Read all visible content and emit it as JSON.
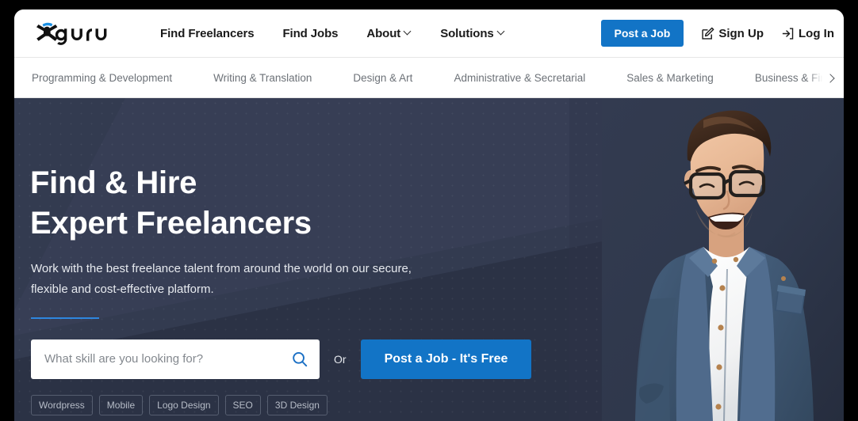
{
  "header": {
    "logo_text": "guru",
    "logo_icon": "guru-stickman-logo",
    "nav": [
      {
        "label": "Find Freelancers",
        "has_dropdown": false
      },
      {
        "label": "Find Jobs",
        "has_dropdown": false
      },
      {
        "label": "About",
        "has_dropdown": true
      },
      {
        "label": "Solutions",
        "has_dropdown": true
      }
    ],
    "post_job_label": "Post a Job",
    "sign_up_label": "Sign Up",
    "sign_up_icon": "pencil-edit-icon",
    "log_in_label": "Log In",
    "log_in_icon": "login-arrow-icon"
  },
  "categories": {
    "items": [
      "Programming & Development",
      "Writing & Translation",
      "Design & Art",
      "Administrative & Secretarial",
      "Sales & Marketing",
      "Business & Finance"
    ],
    "scroll_next_icon": "chevron-right-icon"
  },
  "hero": {
    "title_line1": "Find & Hire",
    "title_line2": "Expert Freelancers",
    "subtitle": "Work with the best freelance talent from around the world on our secure, flexible and cost-effective platform.",
    "search_placeholder": "What skill are you looking for?",
    "search_value": "",
    "search_icon": "magnifier-icon",
    "or_label": "Or",
    "cta_label": "Post a Job - It's Free",
    "chips": [
      "Wordpress",
      "Mobile",
      "Logo Design",
      "SEO",
      "3D Design"
    ],
    "photo_alt": "smiling-man-in-denim-shirt"
  },
  "colors": {
    "brand_blue": "#1274c6",
    "accent_rule": "#2e86de",
    "hero_bg": "#333b50",
    "hero_bg_dark": "#2b3245",
    "logo_accent": "#1a8fe3"
  }
}
